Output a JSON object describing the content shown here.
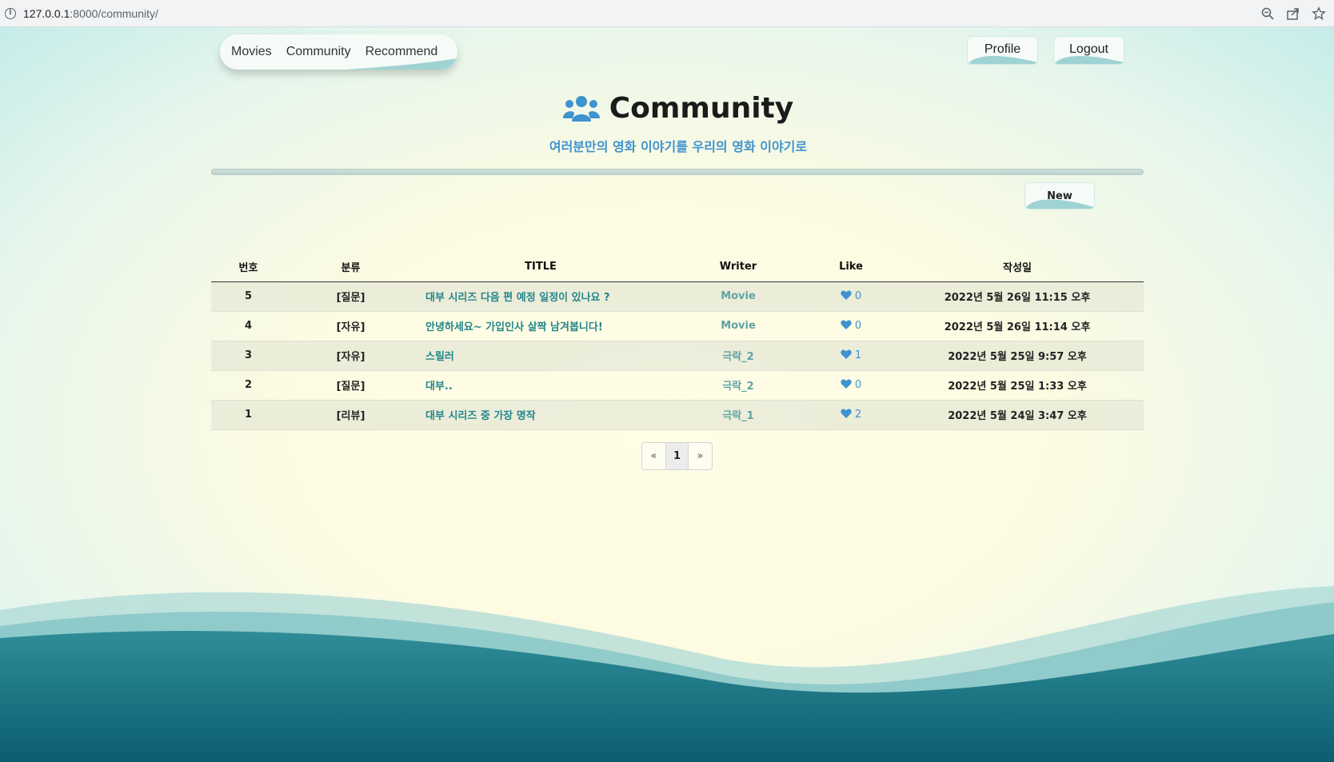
{
  "browser": {
    "url_host": "127.0.0.1",
    "url_path": ":8000/community/"
  },
  "nav": {
    "links": [
      "Movies",
      "Community",
      "Recommend"
    ],
    "profile_label": "Profile",
    "logout_label": "Logout"
  },
  "header": {
    "title": "Community",
    "subtitle": "여러분만의 영화 이야기를 우리의 영화 이야기로"
  },
  "toolbar": {
    "new_label": "New"
  },
  "table": {
    "columns": [
      "번호",
      "분류",
      "TITLE",
      "Writer",
      "Like",
      "작성일"
    ],
    "rows": [
      {
        "no": "5",
        "category": "[질문]",
        "title": "대부 시리즈 다음 편 예정 일정이 있나요 ?",
        "writer": "Movie",
        "likes": "0",
        "date": "2022년 5월 26일 11:15 오후"
      },
      {
        "no": "4",
        "category": "[자유]",
        "title": "안녕하세요~ 가입인사 살짝 남겨봅니다!",
        "writer": "Movie",
        "likes": "0",
        "date": "2022년 5월 26일 11:14 오후"
      },
      {
        "no": "3",
        "category": "[자유]",
        "title": "스릴러",
        "writer": "극락_2",
        "likes": "1",
        "date": "2022년 5월 25일 9:57 오후"
      },
      {
        "no": "2",
        "category": "[질문]",
        "title": "대부..",
        "writer": "극락_2",
        "likes": "0",
        "date": "2022년 5월 25일 1:33 오후"
      },
      {
        "no": "1",
        "category": "[리뷰]",
        "title": "대부 시리즈 중 가장 명작",
        "writer": "극락_1",
        "likes": "2",
        "date": "2022년 5월 24일 3:47 오후"
      }
    ]
  },
  "pagination": {
    "prev": "«",
    "current": "1",
    "next": "»"
  },
  "colors": {
    "accent": "#3f93cf",
    "title_link": "#23868c",
    "wave_dark": "#0f6a7c",
    "wave_light": "#9fd3d3"
  },
  "icons": {
    "title_icon": "users-icon",
    "like_icon": "heart-icon"
  }
}
